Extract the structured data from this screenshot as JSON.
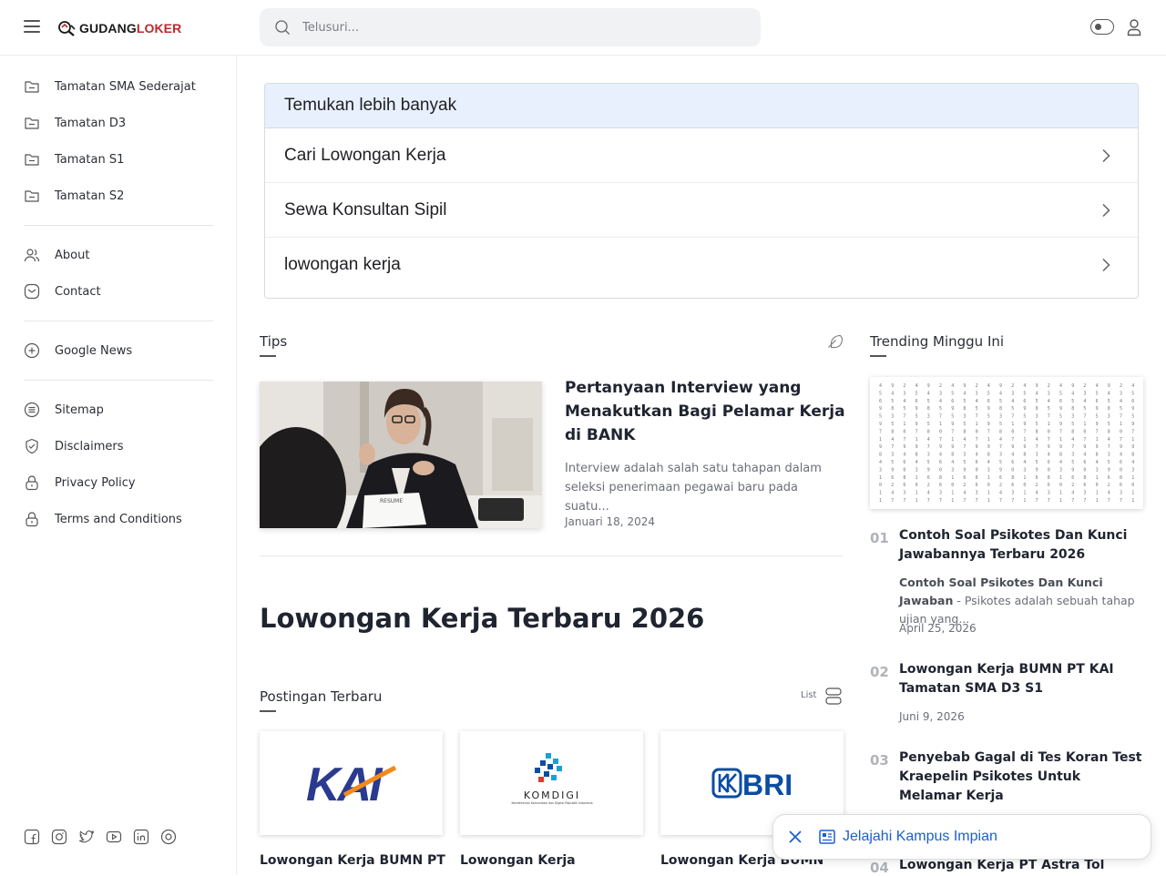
{
  "header": {
    "logo_part1": "GUDANG",
    "logo_part2": "LOKER",
    "search_placeholder": "Telusuri..."
  },
  "sidebar": {
    "groups": [
      [
        "Tamatan SMA Sederajat",
        "Tamatan D3",
        "Tamatan S1",
        "Tamatan S2"
      ],
      [
        "About",
        "Contact"
      ],
      [
        "Google News"
      ],
      [
        "Sitemap",
        "Disclaimers",
        "Privacy Policy",
        "Terms and Conditions"
      ]
    ],
    "socials": [
      "facebook-icon",
      "instagram-icon",
      "twitter-icon",
      "youtube-icon",
      "linkedin-icon",
      "threads-icon"
    ]
  },
  "more": {
    "heading": "Temukan lebih banyak",
    "items": [
      "Cari Lowongan Kerja",
      "Sewa Konsultan Sipil",
      "lowongan kerja"
    ]
  },
  "tips": {
    "title": "Tips",
    "featured": {
      "title": "Pertanyaan Interview yang Menakutkan Bagi Pelamar Kerja di BANK",
      "excerpt": "Interview adalah salah satu tahapan dalam seleksi penerimaan pegawai baru pada suatu...",
      "date": "Januari 18, 2024",
      "image_text": "RESUME"
    }
  },
  "main_heading": "Lowongan Kerja Terbaru 2026",
  "latest": {
    "title": "Postingan Terbaru",
    "view_label": "List",
    "cards": [
      {
        "logo": "KAI",
        "title": "Lowongan Kerja BUMN PT"
      },
      {
        "logo": "KOMDIGI",
        "subtitle": "Kementerian Komunikasi dan Digital Republik Indonesia",
        "title": "Lowongan Kerja"
      },
      {
        "logo": "BRI",
        "title": "Lowongan Kerja BUMN"
      }
    ]
  },
  "trending": {
    "title": "Trending Minggu Ini",
    "items": [
      {
        "num": "01",
        "title": "Contoh Soal Psikotes Dan Kunci Jawabannya Terbaru 2026",
        "excerpt_bold": "Contoh Soal Psikotes Dan Kunci Jawaban",
        "excerpt": " - Psikotes adalah sebuah tahap ujian yang...",
        "date": "April 25, 2026"
      },
      {
        "num": "02",
        "title": "Lowongan Kerja BUMN PT KAI Tamatan SMA D3 S1",
        "date": "Juni 9, 2026"
      },
      {
        "num": "03",
        "title": "Penyebab Gagal di Tes Koran Test Kraepelin Psikotes Untuk Melamar Kerja"
      },
      {
        "num": "04",
        "title": "Lowongan Kerja PT Astra Tol"
      }
    ]
  },
  "popup": {
    "text": "Jelajahi Kampus Impian"
  },
  "colors": {
    "brand_dark": "#1a1a1a",
    "brand_red": "#c0282d",
    "more_header_bg": "#e8f0fe",
    "popup_link": "#1a5fd0",
    "kai_blue": "#2a3a8f",
    "kai_orange": "#f08a1c",
    "bri_blue": "#0a4da2"
  }
}
